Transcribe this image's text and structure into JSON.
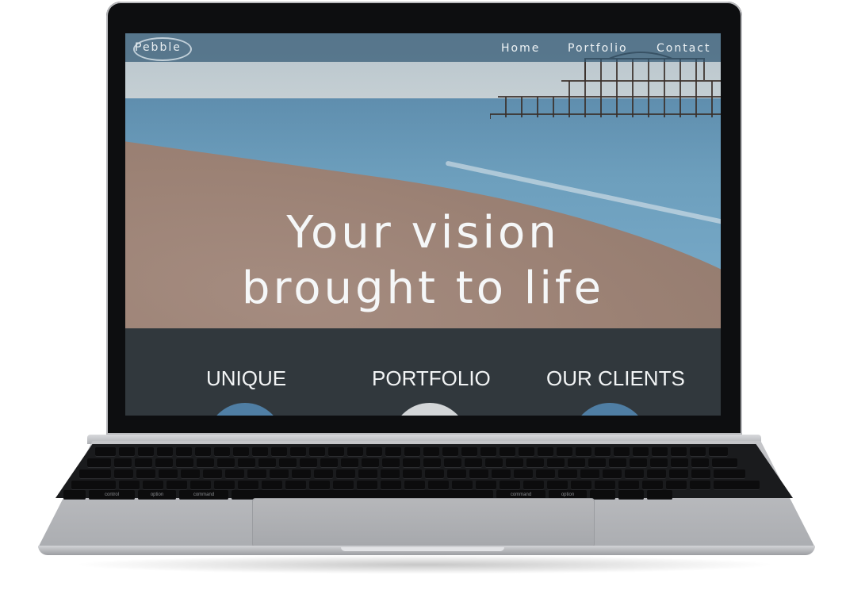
{
  "site": {
    "logo_text": "Pebble",
    "nav": [
      {
        "label": "Home"
      },
      {
        "label": "Portfolio"
      },
      {
        "label": "Contact"
      }
    ],
    "hero": {
      "line1": "Your vision",
      "line2": "brought to life"
    },
    "features": [
      {
        "label": "UNIQUE",
        "circle_color": "#4f7ea4"
      },
      {
        "label": "PORTFOLIO",
        "circle_color": "#d3d6d8"
      },
      {
        "label": "OUR CLIENTS",
        "circle_color": "#4f7ea4"
      }
    ]
  },
  "keyboard": {
    "keys": [
      "control",
      "option",
      "command",
      "command",
      "option"
    ]
  },
  "colors": {
    "navbar": "#305873",
    "band": "#31383d",
    "accent": "#4f7ea4"
  }
}
